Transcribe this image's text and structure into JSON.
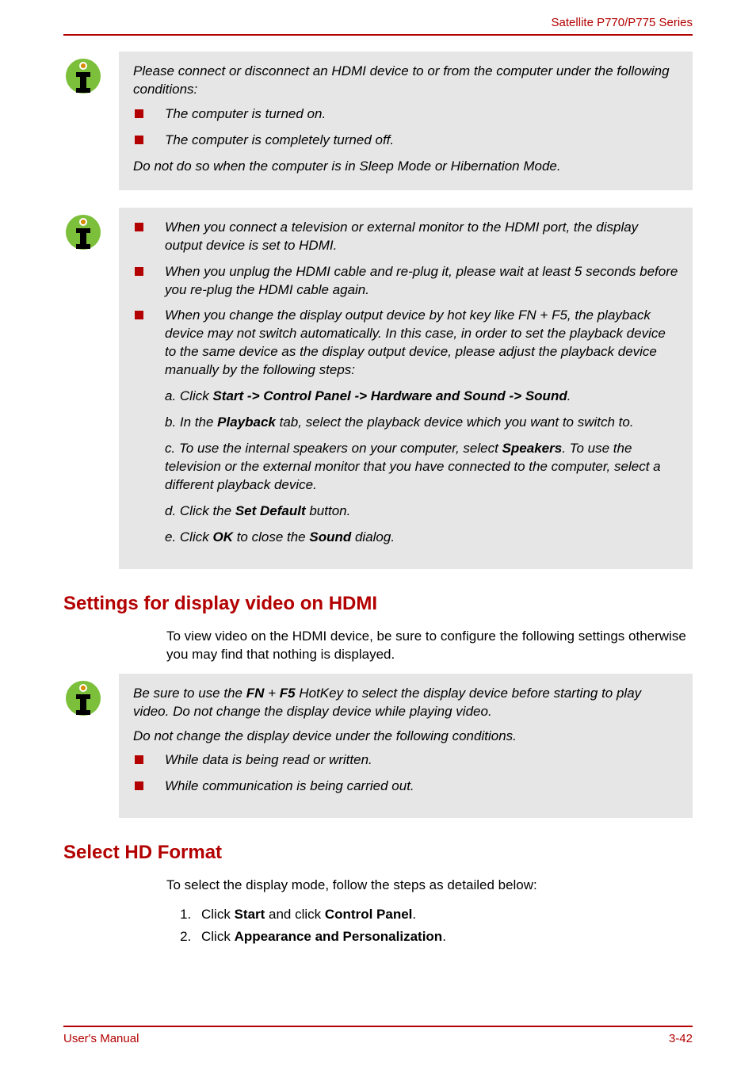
{
  "header": {
    "series": "Satellite P770/P775 Series"
  },
  "note1": {
    "intro": "Please connect or disconnect an HDMI device to or from the computer under the following conditions:",
    "items": [
      "The computer is turned on.",
      "The computer is completely turned off."
    ],
    "outro": "Do not do so when the computer is in Sleep Mode or Hibernation Mode."
  },
  "note2": {
    "items": [
      "When you connect a television or external monitor to the HDMI port, the display output device is set to HDMI.",
      "When you unplug the HDMI cable and re-plug it, please wait at least 5 seconds before you re-plug the HDMI cable again.",
      "When you change the display output device by hot key like FN + F5, the playback device may not switch automatically. In this case, in order to set the playback device to the same device as the display output device, please adjust the playback device manually by the following steps:"
    ],
    "steps": {
      "a_pre": "a. Click ",
      "a_bold": "Start -> Control Panel -> Hardware and Sound -> Sound",
      "a_post": ".",
      "b_pre": "b. In the ",
      "b_bold": "Playback",
      "b_post": " tab, select the playback device which you want to switch to.",
      "c_pre": "c. To use the internal speakers on your computer, select ",
      "c_bold": "Speakers",
      "c_post": ". To use the television or the external monitor that you have connected to the computer, select a different playback device.",
      "d_pre": "d. Click the ",
      "d_bold": "Set Default",
      "d_post": " button.",
      "e_pre": "e. Click ",
      "e_bold1": "OK",
      "e_mid": " to close the ",
      "e_bold2": "Sound",
      "e_post": " dialog."
    }
  },
  "section1": {
    "title": "Settings for display video on HDMI",
    "body": "To view video on the HDMI device, be sure to configure the following settings otherwise you may find that nothing is displayed."
  },
  "note3": {
    "p1_pre": "Be sure to use the ",
    "p1_b1": "FN",
    "p1_plus": " + ",
    "p1_b2": "F5",
    "p1_post": " HotKey to select the display device before starting to play video. Do not change the display device while playing video.",
    "p2": "Do not change the display device under the following conditions.",
    "items": [
      "While data is being read or written.",
      "While communication is being carried out."
    ]
  },
  "section2": {
    "title": "Select HD Format",
    "body": "To select the display mode, follow the steps as detailed below:",
    "li1_pre": "Click ",
    "li1_b1": "Start",
    "li1_mid": " and click ",
    "li1_b2": "Control Panel",
    "li1_post": ".",
    "li2_pre": "Click ",
    "li2_b": "Appearance and Personalization",
    "li2_post": "."
  },
  "footer": {
    "left": "User's Manual",
    "right": "3-42"
  }
}
